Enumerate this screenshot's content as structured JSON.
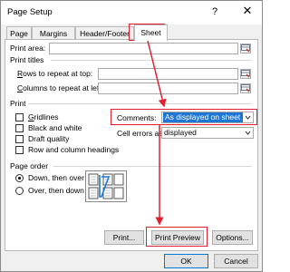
{
  "dialog": {
    "title": "Page Setup",
    "help_glyph": "?",
    "close_glyph": "✕"
  },
  "tabs": [
    {
      "label": "Page",
      "active": false
    },
    {
      "label": "Margins",
      "active": false
    },
    {
      "label": "Header/Footer",
      "active": false
    },
    {
      "label": "Sheet",
      "active": true
    }
  ],
  "print_area": {
    "label": "Print area:",
    "value": ""
  },
  "print_titles": {
    "heading": "Print titles",
    "rows_label": "Rows to repeat at top:",
    "rows_value": "",
    "cols_label": "Columns to repeat at left:",
    "cols_value": ""
  },
  "print": {
    "heading": "Print",
    "options": [
      {
        "label": "Gridlines",
        "checked": false
      },
      {
        "label": "Black and white",
        "checked": false
      },
      {
        "label": "Draft quality",
        "checked": false
      },
      {
        "label": "Row and column headings",
        "checked": false
      }
    ],
    "comments_label": "Comments:",
    "comments_value": "As displayed on sheet",
    "cell_errors_label": "Cell errors as:",
    "cell_errors_value": "displayed"
  },
  "page_order": {
    "heading": "Page order",
    "options": [
      {
        "label": "Down, then over",
        "selected": true
      },
      {
        "label": "Over, then down",
        "selected": false
      }
    ]
  },
  "buttons": {
    "print": "Print...",
    "print_preview": "Print Preview",
    "options": "Options...",
    "ok": "OK",
    "cancel": "Cancel"
  },
  "colors": {
    "highlight_red": "#e0202e",
    "selection_blue": "#1e77d4"
  }
}
